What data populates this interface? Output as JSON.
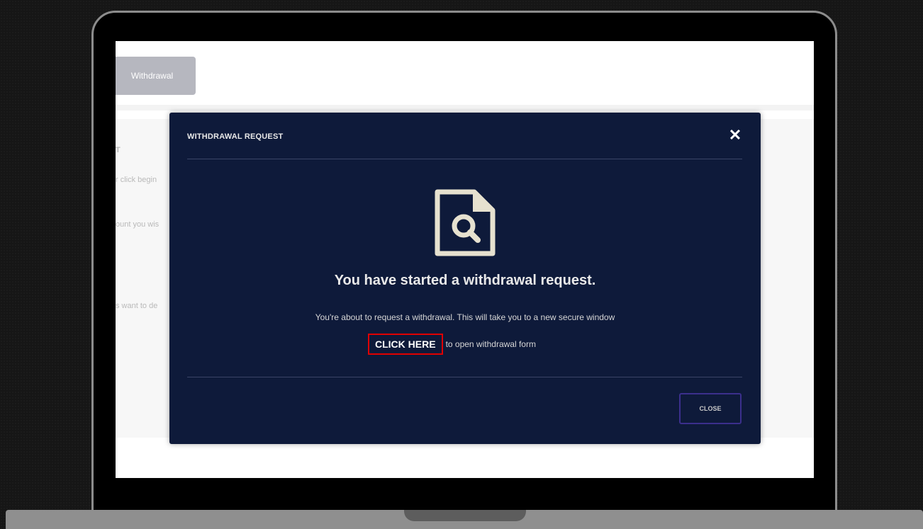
{
  "background_page": {
    "withdraw_button_label": "Withdrawal",
    "fragment_1": "T",
    "fragment_2": "r click begin",
    "fragment_3": "ount you wis",
    "fragment_4": "s want to de"
  },
  "modal": {
    "title": "WITHDRAWAL REQUEST",
    "close_symbol": "✕",
    "icon": "document-search-icon",
    "headline": "You have started a withdrawal request.",
    "description": "You're about to request a withdrawal. This will take you to a new secure window",
    "link_label": "CLICK HERE",
    "link_suffix": "to open withdrawal form",
    "close_button_label": "CLOSE"
  },
  "colors": {
    "modal_background": "#0e1a3a",
    "highlight": "#e00000",
    "close_button_border": "#3b2f8c"
  }
}
